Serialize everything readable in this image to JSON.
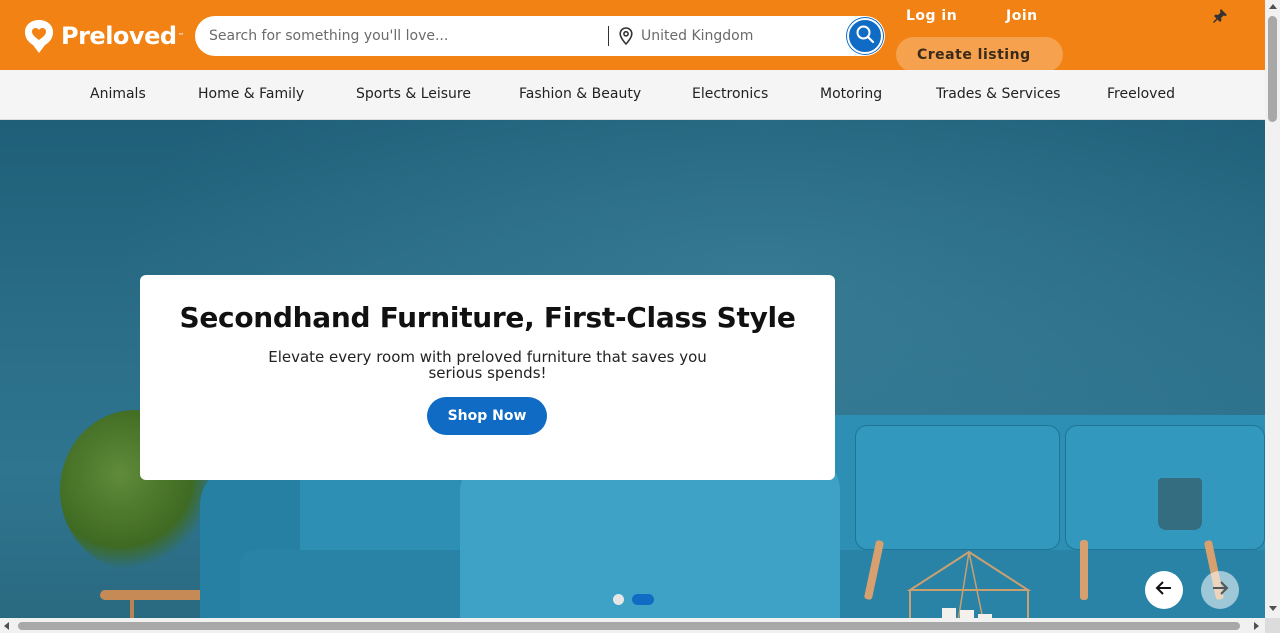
{
  "header": {
    "logo_text": "Preloved",
    "logo_tm": "™",
    "search_placeholder": "Search for something you'll love...",
    "location_placeholder": "United Kingdom",
    "login_label": "Log in",
    "join_label": "Join",
    "create_listing_label": "Create listing",
    "brand_color": "#f28213",
    "accent_color": "#0f6bc4"
  },
  "categories": [
    "Animals",
    "Home & Family",
    "Sports & Leisure",
    "Fashion & Beauty",
    "Electronics",
    "Motoring",
    "Trades & Services",
    "Freeloved"
  ],
  "hero": {
    "title": "Secondhand Furniture, First-Class Style",
    "subtitle": "Elevate every room with preloved furniture that saves you serious spends!",
    "cta_label": "Shop Now",
    "slide_count": 2,
    "active_slide": 2
  },
  "icons": {
    "search": "search-icon",
    "location": "location-pin-icon",
    "pinned": "pushpin-icon",
    "prev": "arrow-left-icon",
    "next": "arrow-right-icon"
  }
}
